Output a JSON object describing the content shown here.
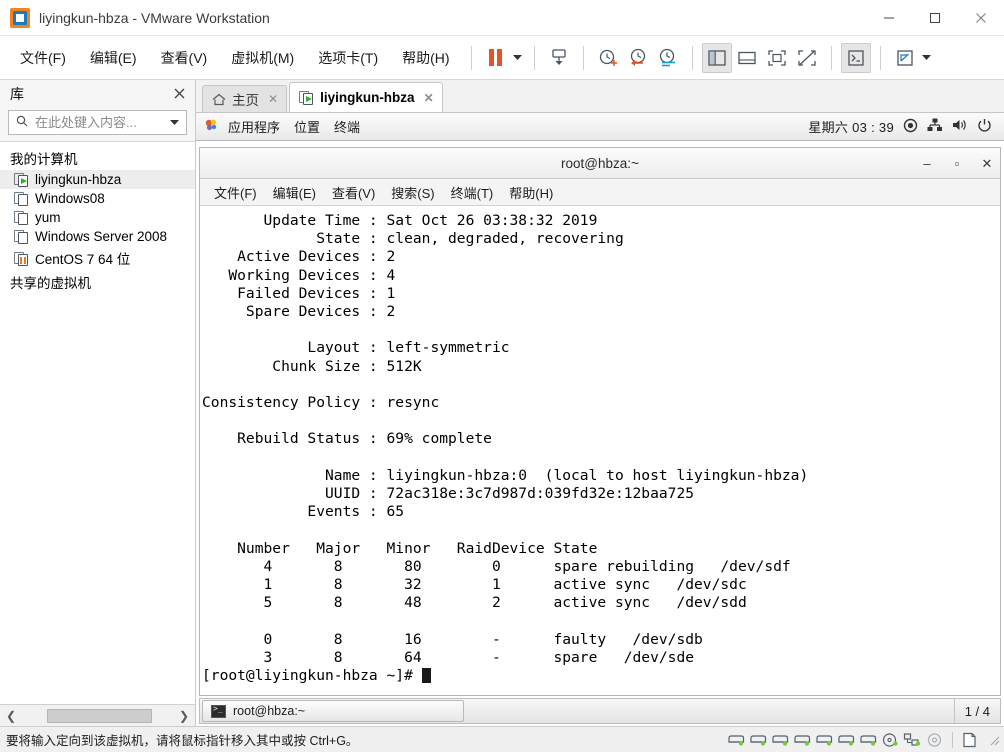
{
  "window": {
    "title": "liyingkun-hbza - VMware Workstation",
    "logo_icon": "vmware-logo-icon",
    "minimize_label": "—",
    "maximize_label": "□",
    "close_label": "✕"
  },
  "menubar": {
    "items": [
      {
        "label": "文件(F)",
        "name": "menu-file"
      },
      {
        "label": "编辑(E)",
        "name": "menu-edit"
      },
      {
        "label": "查看(V)",
        "name": "menu-view"
      },
      {
        "label": "虚拟机(M)",
        "name": "menu-vm"
      },
      {
        "label": "选项卡(T)",
        "name": "menu-tabs"
      },
      {
        "label": "帮助(H)",
        "name": "menu-help"
      }
    ]
  },
  "toolbar": {
    "buttons": [
      {
        "name": "suspend-button",
        "icon": "pause-icon"
      },
      {
        "name": "power-dropdown",
        "icon": "chevron-down-icon"
      },
      {
        "name": "snapshot-button",
        "icon": "take-snapshot-icon"
      },
      {
        "name": "revert-snapshot-button",
        "icon": "clock-plus-icon"
      },
      {
        "name": "restore-snapshot-button",
        "icon": "clock-back-icon"
      },
      {
        "name": "snapshot-manager-button",
        "icon": "clock-manager-icon"
      },
      {
        "name": "show-library-button",
        "icon": "sidebar-panel-icon"
      },
      {
        "name": "show-thumbnails-button",
        "icon": "bottom-panel-icon"
      },
      {
        "name": "fit-guest-button",
        "icon": "fit-window-icon"
      },
      {
        "name": "fit-guest-now-button",
        "icon": "fit-disabled-icon"
      },
      {
        "name": "console-view-button",
        "icon": "terminal-icon"
      },
      {
        "name": "fullscreen-button",
        "icon": "expand-icon"
      },
      {
        "name": "fullscreen-dropdown",
        "icon": "chevron-down-icon"
      }
    ]
  },
  "sidebar": {
    "title": "库",
    "close_icon": "close-icon",
    "search": {
      "placeholder": "在此处键入内容...",
      "value": "",
      "icon": "search-icon",
      "dropdown_icon": "chevron-down-icon"
    },
    "root_label": "我的计算机",
    "items": [
      {
        "label": "liyingkun-hbza",
        "state": "running",
        "selected": true
      },
      {
        "label": "Windows08",
        "state": "off",
        "selected": false
      },
      {
        "label": "yum",
        "state": "off",
        "selected": false
      },
      {
        "label": "Windows Server 2008",
        "state": "off",
        "selected": false
      },
      {
        "label": "CentOS 7 64 位",
        "state": "suspended",
        "selected": false
      }
    ],
    "shared_label": "共享的虚拟机",
    "scroll_left_icon": "chevron-left-icon",
    "scroll_right_icon": "chevron-right-icon"
  },
  "tabs": [
    {
      "label": "主页",
      "icon": "home-icon",
      "active": false,
      "close_icon": "close-icon"
    },
    {
      "label": "liyingkun-hbza",
      "icon": "vm-running-icon",
      "active": true,
      "close_icon": "close-icon"
    }
  ],
  "gnome_panel": {
    "items": [
      {
        "label": "应用程序",
        "name": "gnome-applications-menu"
      },
      {
        "label": "位置",
        "name": "gnome-places-menu"
      },
      {
        "label": "终端",
        "name": "gnome-terminal-menu"
      }
    ],
    "applications_icon": "gnome-foot-icon",
    "clock": "星期六 03 : 39",
    "tray": [
      {
        "name": "accessibility-icon"
      },
      {
        "name": "network-icon"
      },
      {
        "name": "volume-icon"
      },
      {
        "name": "power-icon"
      }
    ]
  },
  "terminal": {
    "title": "root@hbza:~",
    "minimize_label": "–",
    "maximize_label": "▫",
    "close_label": "✕",
    "menu": [
      {
        "label": "文件(F)",
        "name": "term-menu-file"
      },
      {
        "label": "编辑(E)",
        "name": "term-menu-edit"
      },
      {
        "label": "查看(V)",
        "name": "term-menu-view"
      },
      {
        "label": "搜索(S)",
        "name": "term-menu-search"
      },
      {
        "label": "终端(T)",
        "name": "term-menu-terminal"
      },
      {
        "label": "帮助(H)",
        "name": "term-menu-help"
      }
    ],
    "content": "       Update Time : Sat Oct 26 03:38:32 2019\n             State : clean, degraded, recovering\n    Active Devices : 2\n   Working Devices : 4\n    Failed Devices : 1\n     Spare Devices : 2\n\n            Layout : left-symmetric\n        Chunk Size : 512K\n\nConsistency Policy : resync\n\n    Rebuild Status : 69% complete\n\n              Name : liyingkun-hbza:0  (local to host liyingkun-hbza)\n              UUID : 72ac318e:3c7d987d:039fd32e:12baa725\n            Events : 65\n\n    Number   Major   Minor   RaidDevice State\n       4       8       80        0      spare rebuilding   /dev/sdf\n       1       8       32        1      active sync   /dev/sdc\n       5       8       48        2      active sync   /dev/sdd\n\n       0       8       16        -      faulty   /dev/sdb\n       3       8       64        -      spare   /dev/sde\n",
    "prompt": "[root@liyingkun-hbza ~]# ",
    "raid_details": {
      "update_time": "Sat Oct 26 03:38:32 2019",
      "state": "clean, degraded, recovering",
      "active_devices": "2",
      "working_devices": "4",
      "failed_devices": "1",
      "spare_devices": "2",
      "layout": "left-symmetric",
      "chunk_size": "512K",
      "consistency_policy": "resync",
      "rebuild_status": "69% complete",
      "name": "liyingkun-hbza:0  (local to host liyingkun-hbza)",
      "uuid": "72ac318e:3c7d987d:039fd32e:12baa725",
      "events": "65",
      "table_headers": [
        "Number",
        "Major",
        "Minor",
        "RaidDevice",
        "State"
      ],
      "table_rows": [
        [
          "4",
          "8",
          "80",
          "0",
          "spare rebuilding",
          "/dev/sdf"
        ],
        [
          "1",
          "8",
          "32",
          "1",
          "active sync",
          "/dev/sdc"
        ],
        [
          "5",
          "8",
          "48",
          "2",
          "active sync",
          "/dev/sdd"
        ],
        [
          "0",
          "8",
          "16",
          "-",
          "faulty",
          "/dev/sdb"
        ],
        [
          "3",
          "8",
          "64",
          "-",
          "spare",
          "/dev/sde"
        ]
      ]
    }
  },
  "gnome_taskbar": {
    "task_label": "root@hbza:~",
    "task_icon": "terminal-icon",
    "workspace_indicator": "1 / 4"
  },
  "statusbar": {
    "message": "要将输入定向到该虚拟机，请将鼠标指针移入其中或按 Ctrl+G。",
    "devices": [
      {
        "name": "hard-disk-1-icon"
      },
      {
        "name": "hard-disk-2-icon"
      },
      {
        "name": "hard-disk-3-icon"
      },
      {
        "name": "hard-disk-4-icon"
      },
      {
        "name": "hard-disk-5-icon"
      },
      {
        "name": "hard-disk-6-icon"
      },
      {
        "name": "hard-disk-7-icon"
      },
      {
        "name": "cd-dvd-icon"
      },
      {
        "name": "network-adapter-icon"
      },
      {
        "name": "sound-card-icon"
      },
      {
        "name": "printer-icon"
      }
    ]
  },
  "colors": {
    "accent_orange": "#e8541f",
    "accent_blue": "#1a7bbf",
    "running_green": "#2bb32b",
    "chrome_gray": "#f0f0f0"
  }
}
